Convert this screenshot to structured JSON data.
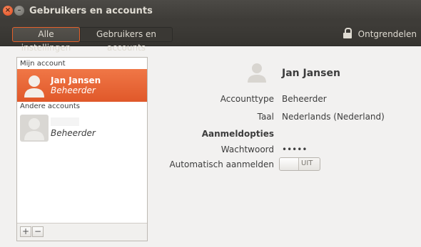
{
  "window": {
    "title": "Gebruikers en accounts",
    "close_glyph": "×",
    "minimize_glyph": "–"
  },
  "toolbar": {
    "all_settings": "Alle instellingen",
    "crumb": "Gebruikers en accounts",
    "unlock": "Ontgrendelen"
  },
  "sidebar": {
    "my_account_label": "Mijn account",
    "other_accounts_label": "Andere accounts",
    "my_account": {
      "name": "Jan Jansen",
      "role": "Beheerder"
    },
    "other_account": {
      "name": "",
      "role": "Beheerder"
    },
    "add_label": "+",
    "remove_label": "−"
  },
  "details": {
    "name": "Jan Jansen",
    "account_type_label": "Accounttype",
    "account_type_value": "Beheerder",
    "language_label": "Taal",
    "language_value": "Nederlands (Nederland)",
    "login_options_heading": "Aanmeldopties",
    "password_label": "Wachtwoord",
    "password_value": "•••••",
    "autologin_label": "Automatisch aanmelden",
    "autologin_state": "UIT"
  },
  "colors": {
    "accent": "#e4602a",
    "selected_row": "#f07746",
    "titlebar": "#3d3b37"
  }
}
